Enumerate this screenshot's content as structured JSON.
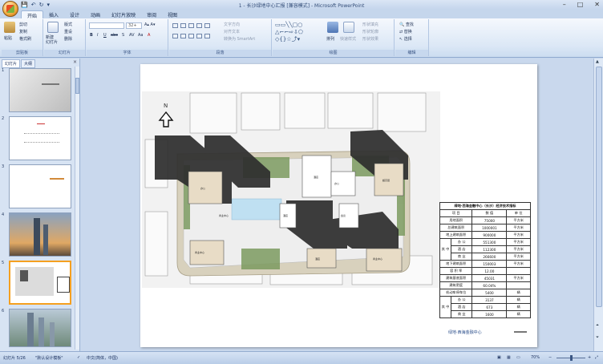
{
  "window": {
    "title": "1 - 长沙绿地中心汇报 [兼容模式] - Microsoft PowerPoint",
    "controls": [
      "–",
      "□",
      "✕"
    ]
  },
  "quick_access": {
    "save": "💾",
    "undo": "↶",
    "redo": "↻",
    "more": "▾"
  },
  "ribbon": {
    "tabs": [
      "开始",
      "插入",
      "设计",
      "动画",
      "幻灯片放映",
      "审阅",
      "视图"
    ],
    "active_tab": "开始",
    "clipboard": {
      "paste": "粘贴",
      "cut": "剪切",
      "copy": "复制",
      "format_painter": "格式刷",
      "label": "剪贴板"
    },
    "slides": {
      "new_slide": "新建\n幻灯片",
      "layout": "版式",
      "reset": "重设",
      "delete": "删除",
      "label": "幻灯片"
    },
    "font": {
      "font_name": "",
      "font_size": "32+",
      "label": "字体",
      "buttons": [
        "B",
        "I",
        "U",
        "abc",
        "S",
        "AV",
        "Aa",
        "A"
      ]
    },
    "paragraph": {
      "label": "段落",
      "text_direction": "文字方向",
      "align_text": "对齐文本",
      "smartart": "转换为 SmartArt"
    },
    "drawing": {
      "label": "绘图",
      "arrange": "排列",
      "quick_styles": "快速样式",
      "shape_fill": "形状填充",
      "shape_outline": "形状轮廓",
      "shape_effects": "形状效果"
    },
    "editing": {
      "label": "编辑",
      "find": "查找",
      "replace": "替换",
      "select": "选择"
    }
  },
  "left_panel": {
    "tabs": [
      "幻灯片",
      "大纲"
    ],
    "active_tab": "幻灯片",
    "close": "×",
    "slide_numbers": [
      "1",
      "2",
      "3",
      "4",
      "5",
      "6"
    ],
    "selected": "5"
  },
  "slide": {
    "tech_table": {
      "title": "绿地·西海金融中心（长沙）经济技术指标",
      "header": [
        "项 目",
        "数 值",
        "单 位"
      ],
      "rows": [
        [
          "用地面积",
          "75000",
          "平方米"
        ],
        [
          "总建筑面积",
          "1000001",
          "平方米"
        ],
        [
          "地上建筑面积",
          "900000",
          "平方米"
        ],
        [
          "办 公",
          "551300",
          "平方米"
        ],
        [
          "酒 店",
          "112300",
          "平方米"
        ],
        [
          "商 业",
          "266600",
          "平方米"
        ],
        [
          "地下建筑面积",
          "150003",
          "平方米"
        ],
        [
          "容 积 率",
          "12.00",
          ""
        ],
        [
          "建筑基底面积",
          "45031",
          "平方米"
        ],
        [
          "建筑密度",
          "60.04%",
          ""
        ],
        [
          "机动车停车位",
          "5400",
          "辆"
        ],
        [
          "办 公",
          "3137",
          "辆"
        ],
        [
          "酒 店",
          "673",
          "辆"
        ],
        [
          "商 业",
          "1600",
          "辆"
        ]
      ],
      "group_label_1": "其 中",
      "group_label_2": "其 中"
    },
    "footer_brand": "绿地·西海金融中心",
    "north_label": "N",
    "building_labels": [
      "办公",
      "商业中心",
      "酒店",
      "超高层",
      "酒店",
      "商业中心",
      "酒店",
      "会议",
      "商业中心",
      "办公"
    ]
  },
  "status_bar": {
    "slide_info": "幻灯片 5/26",
    "theme": "\"默认设计模板\"",
    "language": "中文(简体，中国)",
    "zoom": "70%"
  }
}
